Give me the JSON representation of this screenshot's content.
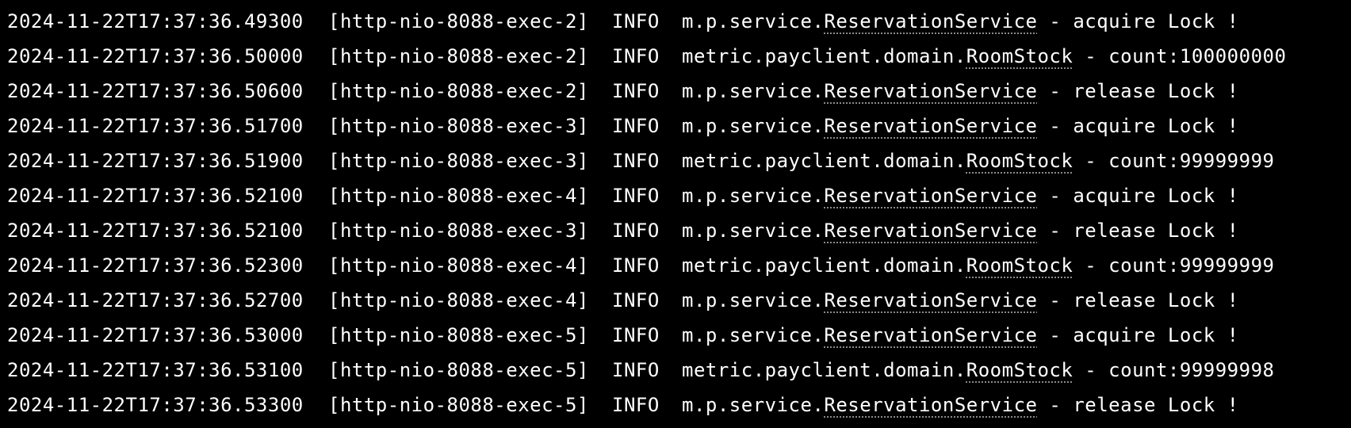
{
  "console": {
    "lines": [
      {
        "timestamp": "2024-11-22T17:37:36.49300",
        "thread": "[http-nio-8088-exec-2]",
        "level": "INFO",
        "logger_pkg": "m.p.service.",
        "logger_class": "ReservationService",
        "message": " - acquire Lock !"
      },
      {
        "timestamp": "2024-11-22T17:37:36.50000",
        "thread": "[http-nio-8088-exec-2]",
        "level": "INFO",
        "logger_pkg": "metric.payclient.domain.",
        "logger_class": "RoomStock",
        "message": " - count:100000000"
      },
      {
        "timestamp": "2024-11-22T17:37:36.50600",
        "thread": "[http-nio-8088-exec-2]",
        "level": "INFO",
        "logger_pkg": "m.p.service.",
        "logger_class": "ReservationService",
        "message": " - release Lock !"
      },
      {
        "timestamp": "2024-11-22T17:37:36.51700",
        "thread": "[http-nio-8088-exec-3]",
        "level": "INFO",
        "logger_pkg": "m.p.service.",
        "logger_class": "ReservationService",
        "message": " - acquire Lock !"
      },
      {
        "timestamp": "2024-11-22T17:37:36.51900",
        "thread": "[http-nio-8088-exec-3]",
        "level": "INFO",
        "logger_pkg": "metric.payclient.domain.",
        "logger_class": "RoomStock",
        "message": " - count:99999999"
      },
      {
        "timestamp": "2024-11-22T17:37:36.52100",
        "thread": "[http-nio-8088-exec-4]",
        "level": "INFO",
        "logger_pkg": "m.p.service.",
        "logger_class": "ReservationService",
        "message": " - acquire Lock !"
      },
      {
        "timestamp": "2024-11-22T17:37:36.52100",
        "thread": "[http-nio-8088-exec-3]",
        "level": "INFO",
        "logger_pkg": "m.p.service.",
        "logger_class": "ReservationService",
        "message": " - release Lock !"
      },
      {
        "timestamp": "2024-11-22T17:37:36.52300",
        "thread": "[http-nio-8088-exec-4]",
        "level": "INFO",
        "logger_pkg": "metric.payclient.domain.",
        "logger_class": "RoomStock",
        "message": " - count:99999999"
      },
      {
        "timestamp": "2024-11-22T17:37:36.52700",
        "thread": "[http-nio-8088-exec-4]",
        "level": "INFO",
        "logger_pkg": "m.p.service.",
        "logger_class": "ReservationService",
        "message": " - release Lock !"
      },
      {
        "timestamp": "2024-11-22T17:37:36.53000",
        "thread": "[http-nio-8088-exec-5]",
        "level": "INFO",
        "logger_pkg": "m.p.service.",
        "logger_class": "ReservationService",
        "message": " - acquire Lock !"
      },
      {
        "timestamp": "2024-11-22T17:37:36.53100",
        "thread": "[http-nio-8088-exec-5]",
        "level": "INFO",
        "logger_pkg": "metric.payclient.domain.",
        "logger_class": "RoomStock",
        "message": " - count:99999998"
      },
      {
        "timestamp": "2024-11-22T17:37:36.53300",
        "thread": "[http-nio-8088-exec-5]",
        "level": "INFO",
        "logger_pkg": "m.p.service.",
        "logger_class": "ReservationService",
        "message": " - release Lock !"
      }
    ]
  },
  "colors": {
    "background": "#000000",
    "text": "#ffffff",
    "link_underline": "#8a8a8a"
  }
}
